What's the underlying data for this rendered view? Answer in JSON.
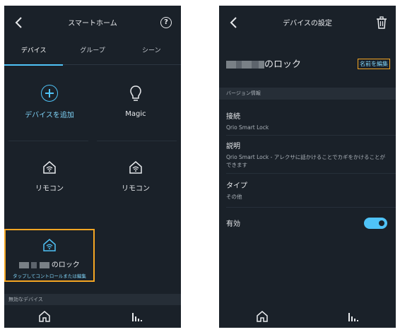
{
  "left": {
    "header": {
      "title": "スマートホーム"
    },
    "tabs": [
      {
        "label": "デバイス",
        "active": true
      },
      {
        "label": "グループ",
        "active": false
      },
      {
        "label": "シーン",
        "active": false
      }
    ],
    "tiles": {
      "add_device": "デバイスを追加",
      "magic": "Magic",
      "remote_1": "リモコン",
      "remote_2": "リモコン",
      "lock_name_suffix": "のロック",
      "lock_hint": "タップしてコントロールまたは編集"
    },
    "section": {
      "inactive_devices": "無効なデバイス"
    }
  },
  "right": {
    "header": {
      "title": "デバイスの設定"
    },
    "device_name_suffix": "のロック",
    "edit_name": "名前を編集",
    "section": {
      "version_info": "バージョン情報"
    },
    "rows": {
      "connection": {
        "title": "接続",
        "value": "Qrio Smart Lock"
      },
      "description": {
        "title": "説明",
        "value": "Qrio Smart Lock - アレクサに話かけることでカギをかけることができます"
      },
      "type": {
        "title": "タイプ",
        "value": "その他"
      },
      "enabled": {
        "title": "有効",
        "on": true
      }
    }
  },
  "colors": {
    "accent": "#4fc3f7",
    "highlight": "#f5a623",
    "background": "#1a2129"
  }
}
